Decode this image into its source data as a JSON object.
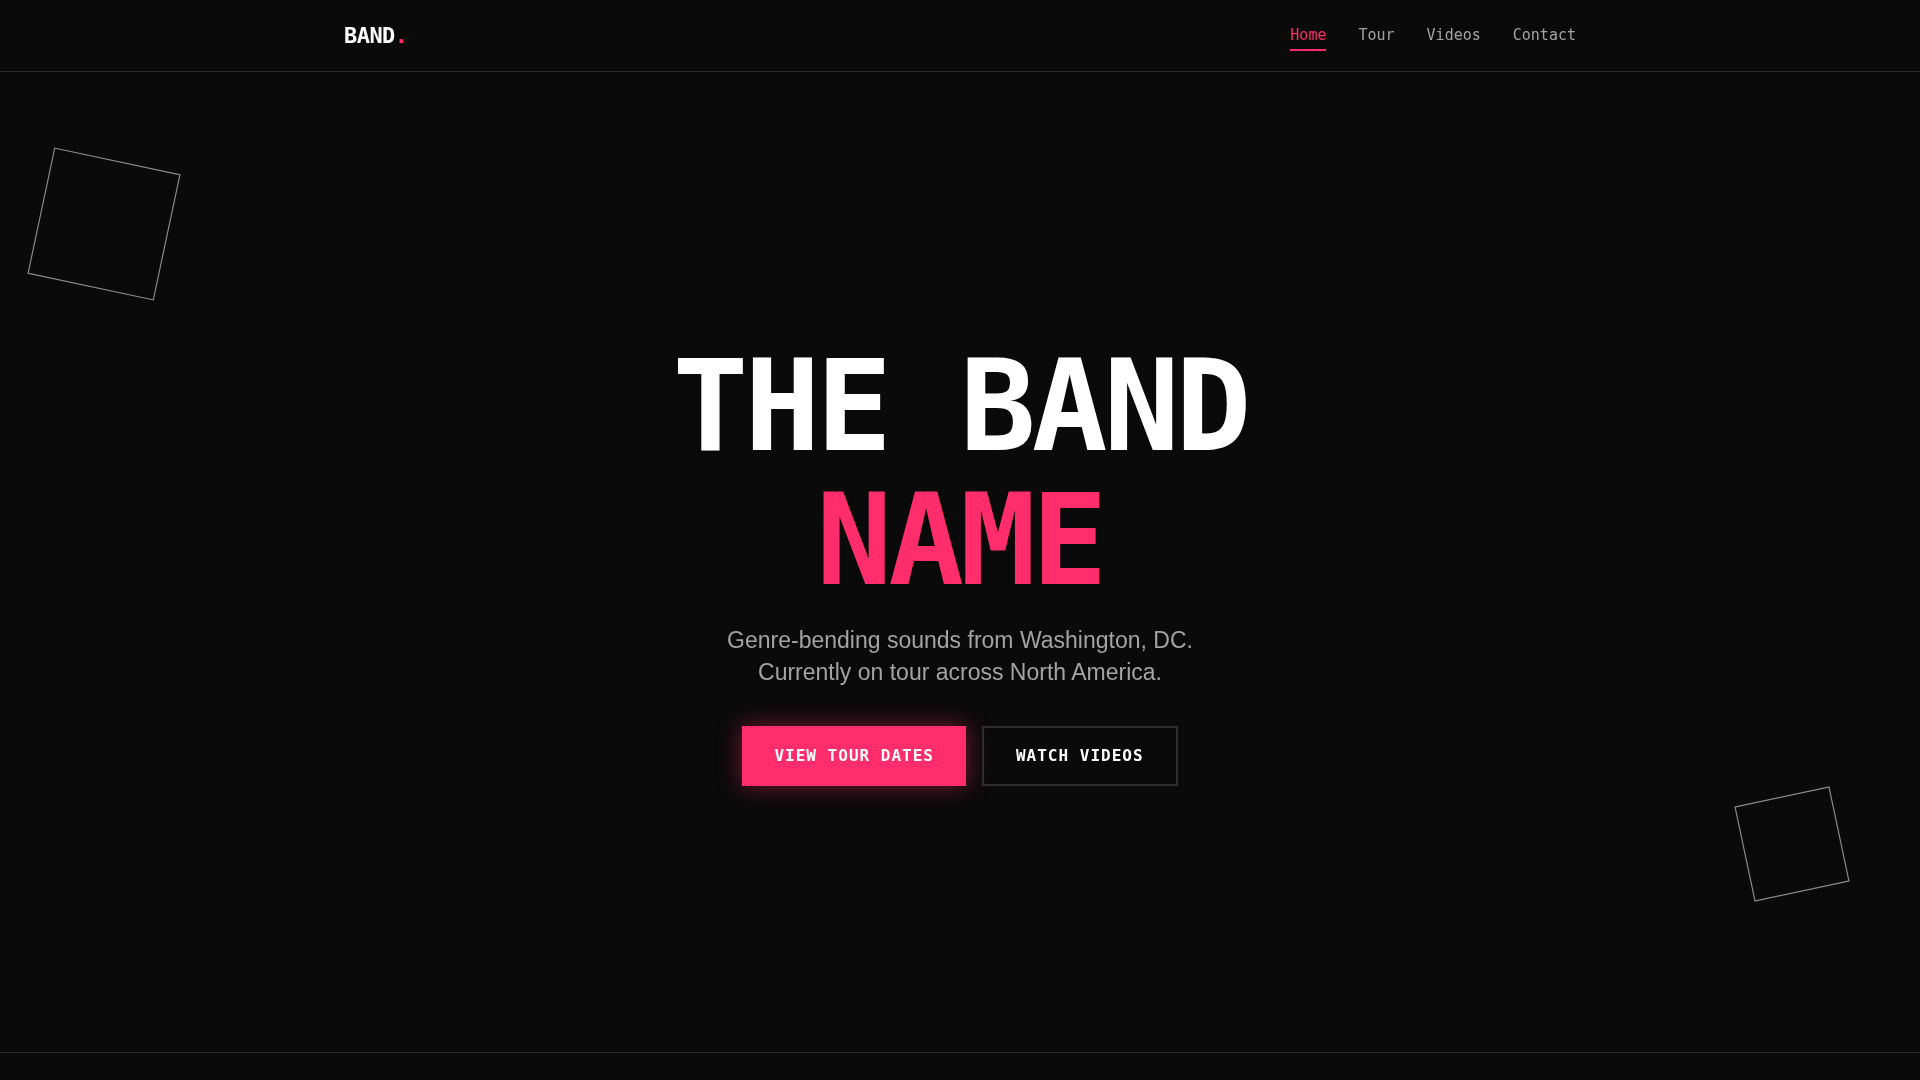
{
  "logo": {
    "text": "BAND",
    "accent": "."
  },
  "nav": [
    {
      "label": "Home",
      "selected": true
    },
    {
      "label": "Tour",
      "selected": false
    },
    {
      "label": "Videos",
      "selected": false
    },
    {
      "label": "Contact",
      "selected": false
    }
  ],
  "hero": {
    "title_line_1": "THE BAND",
    "title_line_2": "NAME",
    "subtitle": [
      "Genre-bending sounds from Washington, DC.",
      "Currently on tour across North America."
    ],
    "buttons": [
      {
        "label": "VIEW TOUR DATES",
        "kind": "primary"
      },
      {
        "label": "WATCH VIDEOS",
        "kind": "outline"
      }
    ]
  }
}
